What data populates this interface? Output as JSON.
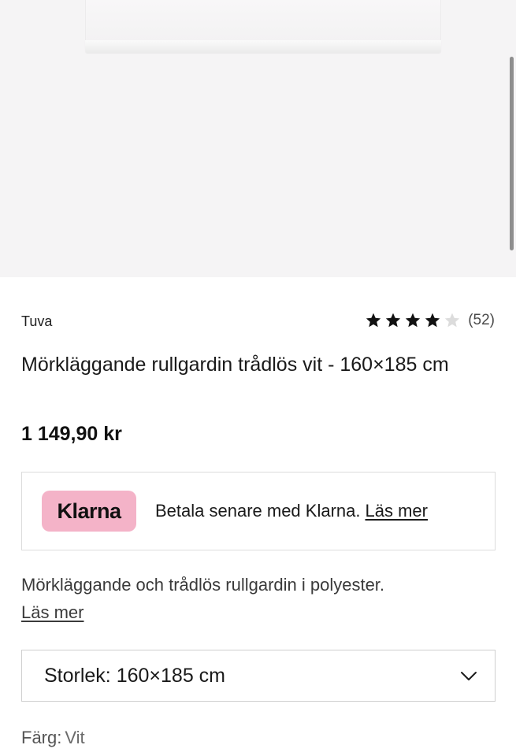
{
  "product": {
    "brand": "Tuva",
    "title": "Mörkläggande rullgardin trådlös vit - 160×185 cm",
    "price": "1 149,90 kr",
    "rating": {
      "stars_filled": 4,
      "stars_total": 5,
      "count": "(52)"
    },
    "description": "Mörkläggande och trådlös rullgardin i polyester.",
    "read_more": "Läs mer"
  },
  "klarna": {
    "badge": "Klarna",
    "text": "Betala senare med Klarna.",
    "link": "Läs mer",
    "badge_color": "#f4b3c8"
  },
  "size_select": {
    "label": "Storlek: 160×185 cm",
    "icon": "chevron-down-icon"
  },
  "color": {
    "label": "Färg:",
    "value": "Vit"
  },
  "colors": {
    "image_background": "#f5f4f5",
    "star_filled": "#111111",
    "star_empty": "#dcdcdc"
  }
}
